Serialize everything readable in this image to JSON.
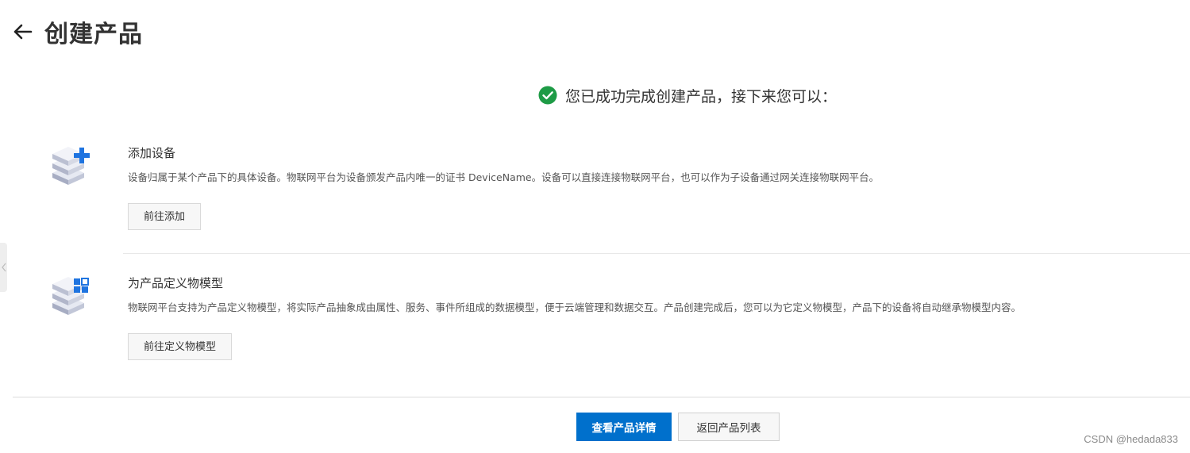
{
  "header": {
    "title": "创建产品",
    "back_icon": "arrow-left-icon"
  },
  "success": {
    "icon": "check-circle-icon",
    "icon_color": "#1e9b46",
    "message": "您已成功完成创建产品，接下来您可以："
  },
  "sections": [
    {
      "icon": "cube-stack-plus-icon",
      "title": "添加设备",
      "description": "设备归属于某个产品下的具体设备。物联网平台为设备颁发产品内唯一的证书 DeviceName。设备可以直接连接物联网平台，也可以作为子设备通过网关连接物联网平台。",
      "button_label": "前往添加"
    },
    {
      "icon": "cube-stack-grid-icon",
      "title": "为产品定义物模型",
      "description": "物联网平台支持为产品定义物模型，将实际产品抽象成由属性、服务、事件所组成的数据模型，便于云端管理和数据交互。产品创建完成后，您可以为它定义物模型，产品下的设备将自动继承物模型内容。",
      "button_label": "前往定义物模型"
    }
  ],
  "footer": {
    "primary_label": "查看产品详情",
    "secondary_label": "返回产品列表"
  },
  "accent_color": "#0070cc",
  "watermark": "CSDN @hedada833"
}
